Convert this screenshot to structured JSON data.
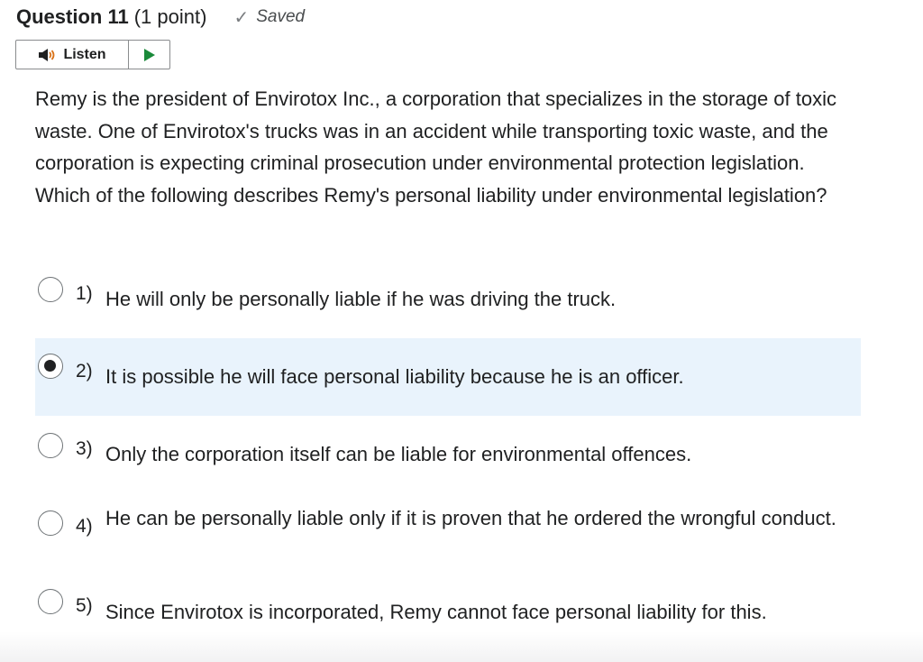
{
  "header": {
    "question_label": "Question 11",
    "points": "(1 point)",
    "status": "Saved",
    "status_icon": "check-icon"
  },
  "listen": {
    "label": "Listen",
    "speaker_icon": "speaker-icon",
    "play_icon": "play-icon"
  },
  "question": {
    "text": "Remy is the president of Envirotox Inc., a corporation that specializes in the storage of toxic waste. One of Envirotox's trucks was in an accident while transporting toxic waste, and the corporation is expecting criminal prosecution under environmental protection legislation. Which of the following describes Remy's personal liability under environmental legislation?"
  },
  "options": [
    {
      "number": "1)",
      "text": "He will only be personally liable if he was driving the truck.",
      "selected": false
    },
    {
      "number": "2)",
      "text": "It is possible he will face personal liability because he is an officer.",
      "selected": true
    },
    {
      "number": "3)",
      "text": "Only the corporation itself can be liable for environmental offences.",
      "selected": false
    },
    {
      "number": "4)",
      "text": "He can be personally liable only if it is proven that he ordered the wrongful conduct.",
      "selected": false
    },
    {
      "number": "5)",
      "text": "Since Envirotox is incorporated, Remy cannot face personal liability for this.",
      "selected": false
    }
  ],
  "colors": {
    "selected_background": "#e9f3fc",
    "text": "#202122",
    "play_green": "#1a8a3a",
    "speaker_orange": "#d9731a"
  }
}
